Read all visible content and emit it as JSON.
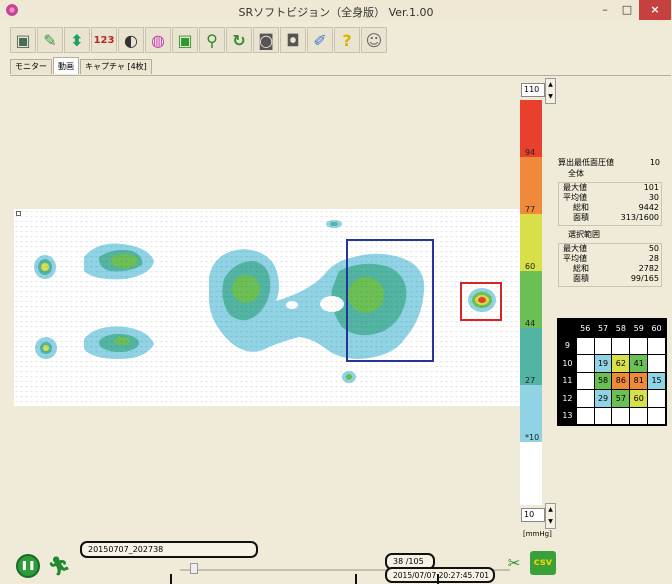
{
  "window": {
    "title": "SRソフトビジョン（全身版） Ver.1.00",
    "minimize": "–",
    "maximize": "□",
    "close": "×"
  },
  "toolbar": [
    {
      "name": "monitor-icon",
      "glyph": "▣",
      "color": "#4a6b55"
    },
    {
      "name": "open-folder-icon",
      "glyph": "✎",
      "color": "#3c9b3c"
    },
    {
      "name": "up-down-arrows-icon",
      "glyph": "⬍",
      "color": "#1ba06a"
    },
    {
      "name": "number-123-icon",
      "glyph": "123",
      "color": "#b02a2a"
    },
    {
      "name": "contrast-icon",
      "glyph": "◐",
      "color": "#333"
    },
    {
      "name": "color-wheel-icon",
      "glyph": "◍",
      "color": "#c640b8"
    },
    {
      "name": "fit-frame-icon",
      "glyph": "▣",
      "color": "#2e9a2e"
    },
    {
      "name": "zoom-icon",
      "glyph": "⚲",
      "color": "#2b8a2b"
    },
    {
      "name": "rotate-icon",
      "glyph": "↻",
      "color": "#2b8a2b"
    },
    {
      "name": "camera-icon",
      "glyph": "◙",
      "color": "#555"
    },
    {
      "name": "video-camera-icon",
      "glyph": "◘",
      "color": "#555"
    },
    {
      "name": "wrench-icon",
      "glyph": "✐",
      "color": "#3a7ad0"
    },
    {
      "name": "help-icon",
      "glyph": "?",
      "color": "#d6b800"
    },
    {
      "name": "user-icon",
      "glyph": "☺",
      "color": "#666"
    }
  ],
  "tabs": [
    "モニター",
    "動画",
    "キャプチャ [4枚]"
  ],
  "scale": {
    "top_spin": "110",
    "bottom_spin": "10",
    "unit": "[mmHg]",
    "labels": [
      {
        "text": "94"
      },
      {
        "text": "77"
      },
      {
        "text": "60"
      },
      {
        "text": "44"
      },
      {
        "text": "27"
      },
      {
        "text": "*10"
      }
    ],
    "colors": [
      "#e8402d",
      "#f08a3a",
      "#d8df48",
      "#6bbf54",
      "#52b4a2",
      "#8fd3e4",
      "#ffffff"
    ]
  },
  "stats": {
    "threshold_label": "算出最低面圧値",
    "threshold_value": "10",
    "all_title": "全体",
    "all": [
      {
        "k": "最大値",
        "v": "101"
      },
      {
        "k": "平均値",
        "v": "30"
      },
      {
        "k": "総和",
        "v": "9442"
      },
      {
        "k": "面積",
        "v": "313/1600"
      }
    ],
    "sel_title": "選択範囲",
    "sel": [
      {
        "k": "最大値",
        "v": "50"
      },
      {
        "k": "平均値",
        "v": "28"
      },
      {
        "k": "総和",
        "v": "2782"
      },
      {
        "k": "面積",
        "v": "99/165"
      }
    ]
  },
  "grid": {
    "cols": [
      "56",
      "57",
      "58",
      "59",
      "60"
    ],
    "rows": [
      {
        "label": "9",
        "cells": [
          "",
          "",
          "",
          "",
          ""
        ]
      },
      {
        "label": "10",
        "cells": [
          "",
          "19",
          "62",
          "41",
          ""
        ]
      },
      {
        "label": "11",
        "cells": [
          "",
          "58",
          "86",
          "81",
          "15"
        ]
      },
      {
        "label": "12",
        "cells": [
          "",
          "29",
          "57",
          "60",
          ""
        ]
      },
      {
        "label": "13",
        "cells": [
          "",
          "",
          "",
          "",
          ""
        ]
      }
    ],
    "cell_colors": {
      "15": "#8fd3e4",
      "19": "#8fd3e4",
      "29": "#8fd3e4",
      "41": "#6bbf54",
      "57": "#6bbf54",
      "58": "#6bbf54",
      "60": "#d8df48",
      "62": "#d8df48",
      "81": "#f08a3a",
      "86": "#f08a3a"
    }
  },
  "bottom": {
    "filename": "20150707_202738",
    "frame": "38  /105",
    "timestamp": "2015/07/07 20:27:45.701",
    "csv_label": "csv"
  }
}
